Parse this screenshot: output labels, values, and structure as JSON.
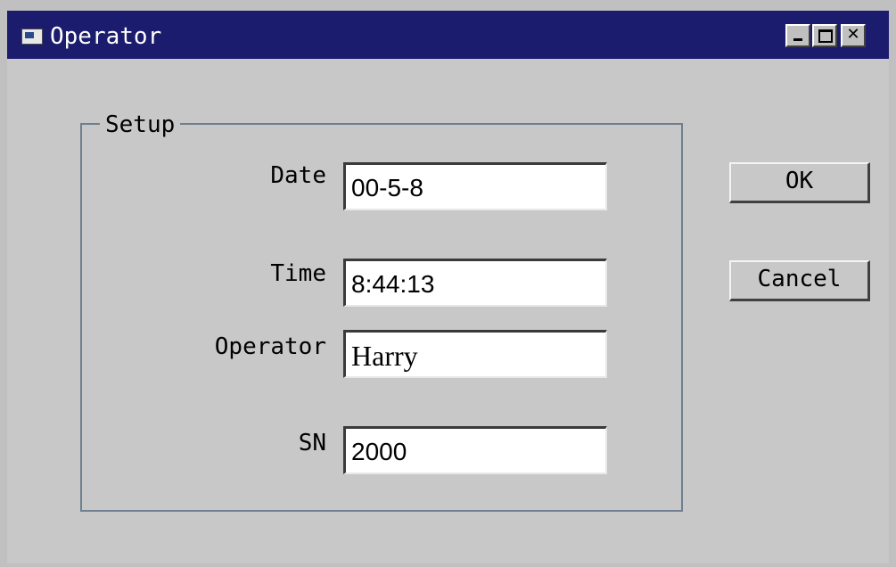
{
  "window": {
    "title": "Operator"
  },
  "titlebar_buttons": {
    "close_glyph": "✕"
  },
  "group": {
    "label": "Setup"
  },
  "fields": {
    "date": {
      "label": "Date",
      "value": "00-5-8"
    },
    "time": {
      "label": "Time",
      "value": "8:44:13"
    },
    "operator": {
      "label": "Operator",
      "value": "Harry"
    },
    "sn": {
      "label": "SN",
      "value": "2000"
    }
  },
  "buttons": {
    "ok": "OK",
    "cancel": "Cancel"
  },
  "colors": {
    "titlebar": "#1c1c6e",
    "face": "#c8c8c8"
  }
}
